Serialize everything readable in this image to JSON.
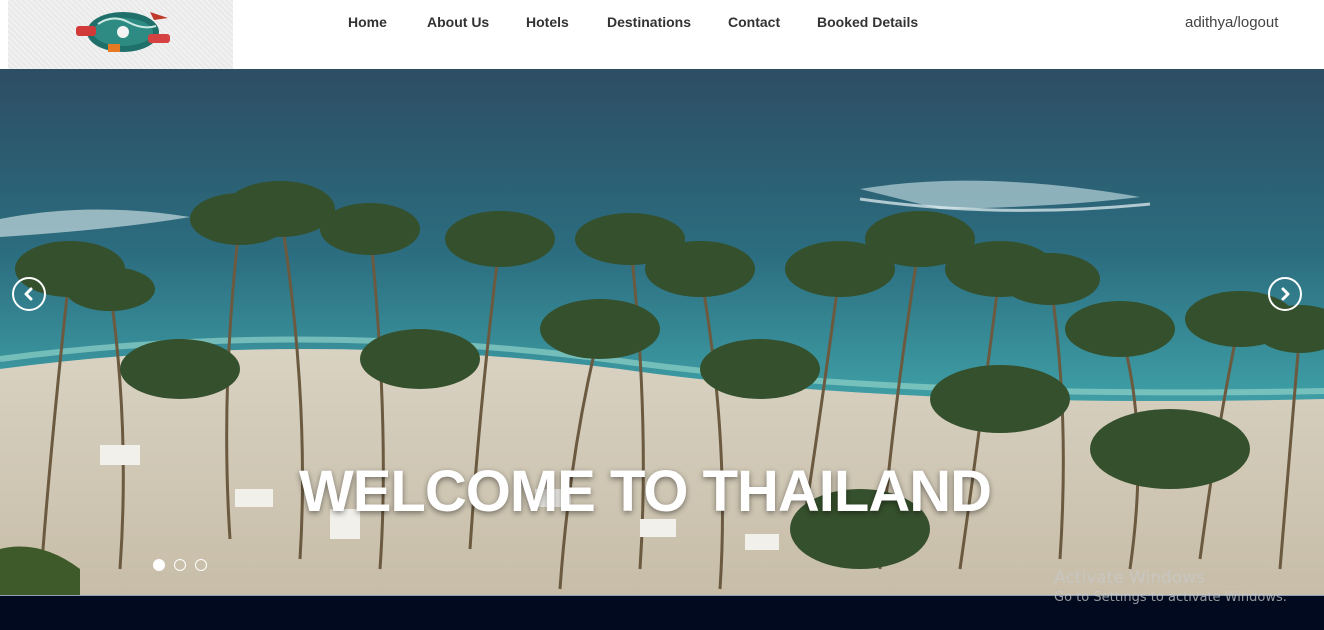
{
  "nav": {
    "items": [
      {
        "label": "Home"
      },
      {
        "label": "About Us"
      },
      {
        "label": "Hotels"
      },
      {
        "label": "Destinations"
      },
      {
        "label": "Contact"
      },
      {
        "label": "Booked Details"
      }
    ],
    "user_link": "adithya/logout"
  },
  "hero": {
    "title": "WELCOME TO THAILAND",
    "slides": 3,
    "active_slide": 1
  },
  "icons": {
    "prev": "chevron-left-icon",
    "next": "chevron-right-icon",
    "logo": "travel-globe-logo"
  },
  "watermark": {
    "line1": "Activate Windows",
    "line2": "Go to Settings to activate Windows."
  },
  "colors": {
    "footer": "#020a1f",
    "nav_text": "#333333",
    "title": "#ffffff"
  }
}
